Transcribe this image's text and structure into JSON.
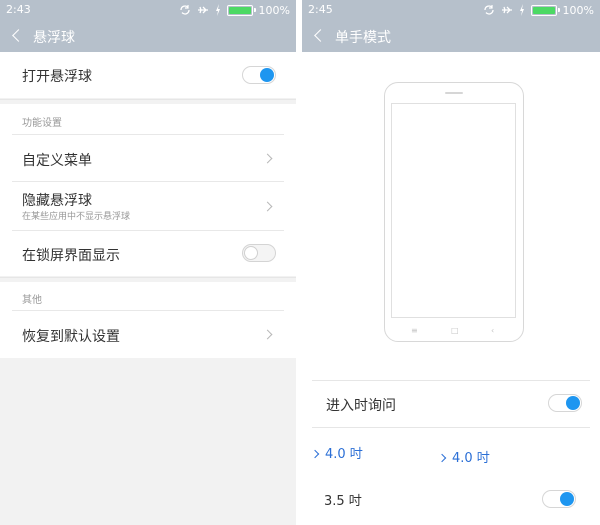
{
  "left": {
    "status": {
      "time": "2:43",
      "battery_pct": "100%"
    },
    "title": "悬浮球",
    "rows": {
      "open": {
        "label": "打开悬浮球"
      },
      "group1": "功能设置",
      "custom_menu": {
        "label": "自定义菜单"
      },
      "hide_ball": {
        "label": "隐藏悬浮球",
        "sub": "在某些应用中不显示悬浮球"
      },
      "lockscreen": {
        "label": "在锁屏界面显示"
      },
      "group2": "其他",
      "reset": {
        "label": "恢复到默认设置"
      }
    },
    "toggles": {
      "open": "on",
      "lockscreen": "off"
    }
  },
  "right": {
    "status": {
      "time": "2:45",
      "battery_pct": "100%"
    },
    "title": "单手模式",
    "phone_nav": {
      "menu": "≡",
      "home": "□",
      "back": "‹"
    },
    "rows": {
      "ask": {
        "label": "进入时询问"
      },
      "size_a": "4.0 吋",
      "size_b": "4.0 吋",
      "size_c": "3.5 吋"
    },
    "toggles": {
      "ask": "on",
      "bottom": "on"
    }
  },
  "colors": {
    "titlebar": "#b6c0cb",
    "accent": "#1e96f0",
    "link": "#2b6fd6"
  }
}
